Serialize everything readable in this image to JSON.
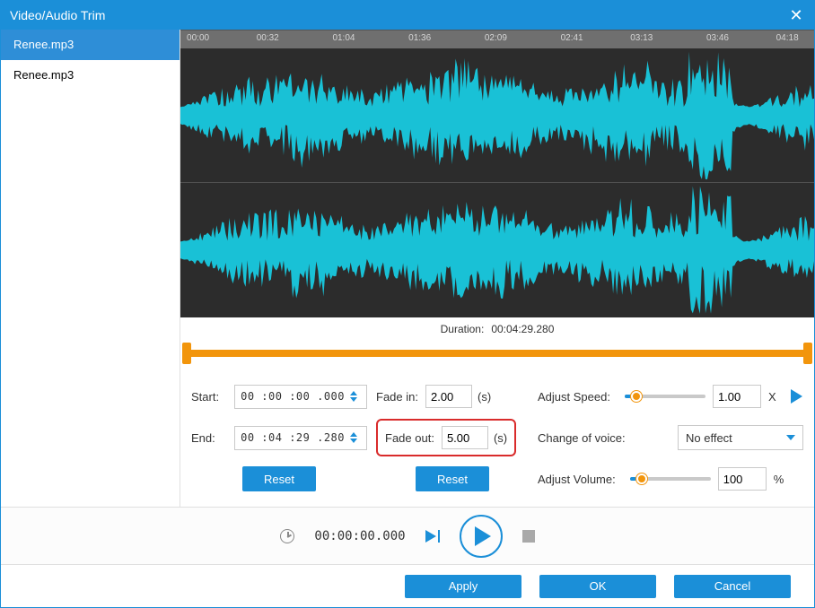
{
  "title": "Video/Audio Trim",
  "sidebar": {
    "items": [
      "Renee.mp3",
      "Renee.mp3"
    ],
    "active_index": 0
  },
  "timeline_ticks": [
    "00:00",
    "00:32",
    "01:04",
    "01:36",
    "02:09",
    "02:41",
    "03:13",
    "03:46",
    "04:18"
  ],
  "duration": {
    "label": "Duration:",
    "value": "00:04:29.280"
  },
  "trim": {
    "start_label": "Start:",
    "start_value": "00 :00 :00 .000",
    "end_label": "End:",
    "end_value": "00 :04 :29 .280",
    "reset": "Reset"
  },
  "fade": {
    "in_label": "Fade in:",
    "in_value": "2.00",
    "in_unit": "(s)",
    "out_label": "Fade out:",
    "out_value": "5.00",
    "out_unit": "(s)",
    "reset": "Reset"
  },
  "adjust": {
    "speed_label": "Adjust Speed:",
    "speed_value": "1.00",
    "speed_unit": "X",
    "voice_label": "Change of voice:",
    "voice_value": "No effect",
    "volume_label": "Adjust Volume:",
    "volume_value": "100",
    "volume_unit": "%"
  },
  "playback": {
    "time": "00:00:00.000"
  },
  "buttons": {
    "apply": "Apply",
    "ok": "OK",
    "cancel": "Cancel"
  }
}
